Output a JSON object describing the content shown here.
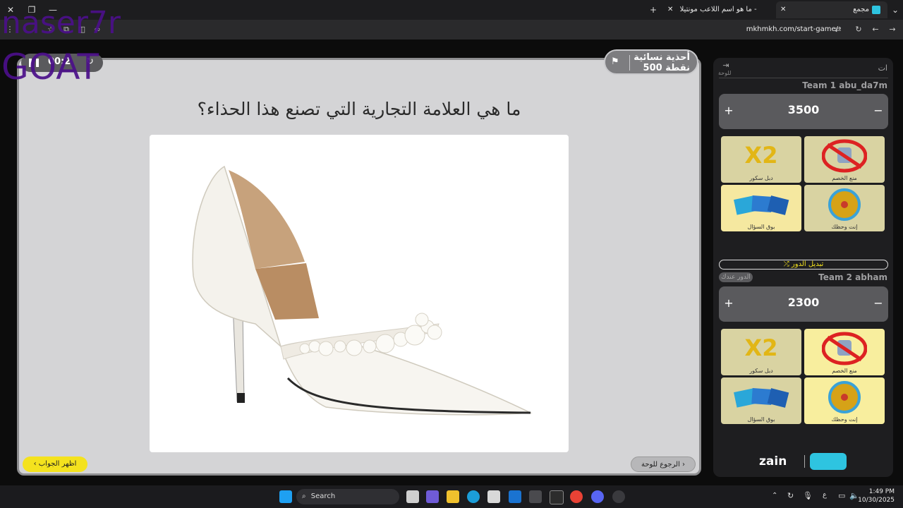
{
  "browser": {
    "tabs": [
      {
        "label": "مجمع"
      },
      {
        "label": "ما هو اسم اللاعب مونتيلا - earch"
      }
    ],
    "url": "mkhmkh.com/start-game/"
  },
  "overlay_text": {
    "line1": "naser7r",
    "line2": "GOAT"
  },
  "game": {
    "timer": "00:2",
    "category": {
      "name": "أحذية نسائية",
      "points": "500 نقطة"
    },
    "question": "ما هي العلامة التجارية التي تصنع هذا الحذاء؟",
    "show_answer_label": "اظهر الجواب",
    "back_to_board_label": "الرجوع للوحة"
  },
  "panel": {
    "top_label": "ات",
    "exit_label": "للوحة",
    "teams": [
      {
        "name": "Team 1 abu_da7m",
        "score": "3500",
        "powerups": [
          "دبل سكور",
          "منع الخصم",
          "بوق السؤال",
          "إنت وحظك"
        ]
      },
      {
        "name": "Team 2 abham",
        "score": "2300",
        "powerups": [
          "دبل سكور",
          "منع الخصم",
          "بوق السؤال",
          "إنت وحظك"
        ]
      }
    ],
    "switch_turn_label": "تبديل الدور",
    "turn_badge": "الدور عندك",
    "logos": {
      "brand": "zain"
    }
  },
  "taskbar": {
    "search_placeholder": "Search",
    "time": "1:49 PM",
    "date": "10/30/2025"
  }
}
